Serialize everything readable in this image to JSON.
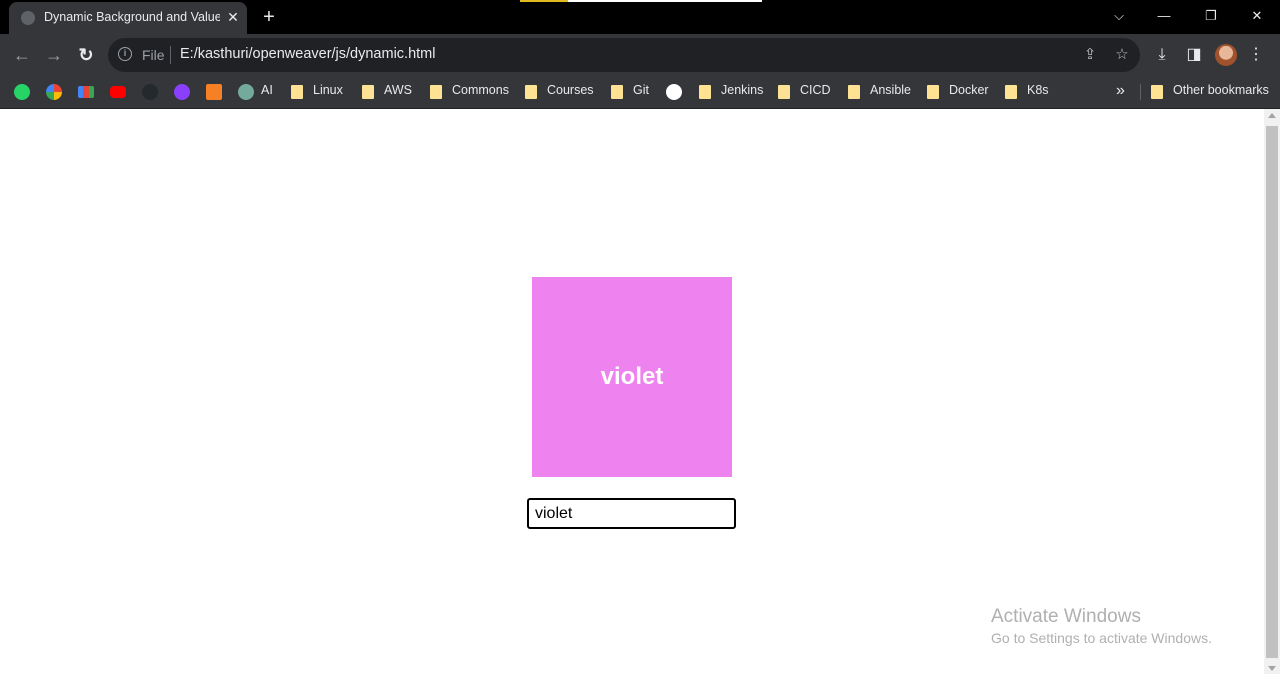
{
  "browser": {
    "tab_title": "Dynamic Background and Value U",
    "tab_close": "✕",
    "new_tab": "+",
    "controls": {
      "dropdown": "⌵",
      "minimize": "—",
      "restore": "❐",
      "close": "✕"
    }
  },
  "toolbar": {
    "back": "←",
    "forward": "→",
    "reload": "↻",
    "info": "i",
    "scheme": "File",
    "url": "E:/kasthuri/openweaver/js/dynamic.html",
    "share": "⇪",
    "star": "☆",
    "download": "⤓",
    "sidepanel": "◨",
    "menu": "⋮"
  },
  "bookmarks": {
    "items": [
      {
        "label": "AI"
      },
      {
        "label": "Linux"
      },
      {
        "label": "AWS"
      },
      {
        "label": "Commons"
      },
      {
        "label": "Courses"
      },
      {
        "label": "Git"
      },
      {
        "label": "Jenkins"
      },
      {
        "label": "CICD"
      },
      {
        "label": "Ansible"
      },
      {
        "label": "Docker"
      },
      {
        "label": "K8s"
      }
    ],
    "more": "»",
    "other": "Other bookmarks"
  },
  "page": {
    "box_color": "#ee82ee",
    "box_label": "violet",
    "input_value": "violet"
  },
  "watermark": {
    "line1": "Activate Windows",
    "line2": "Go to Settings to activate Windows."
  }
}
